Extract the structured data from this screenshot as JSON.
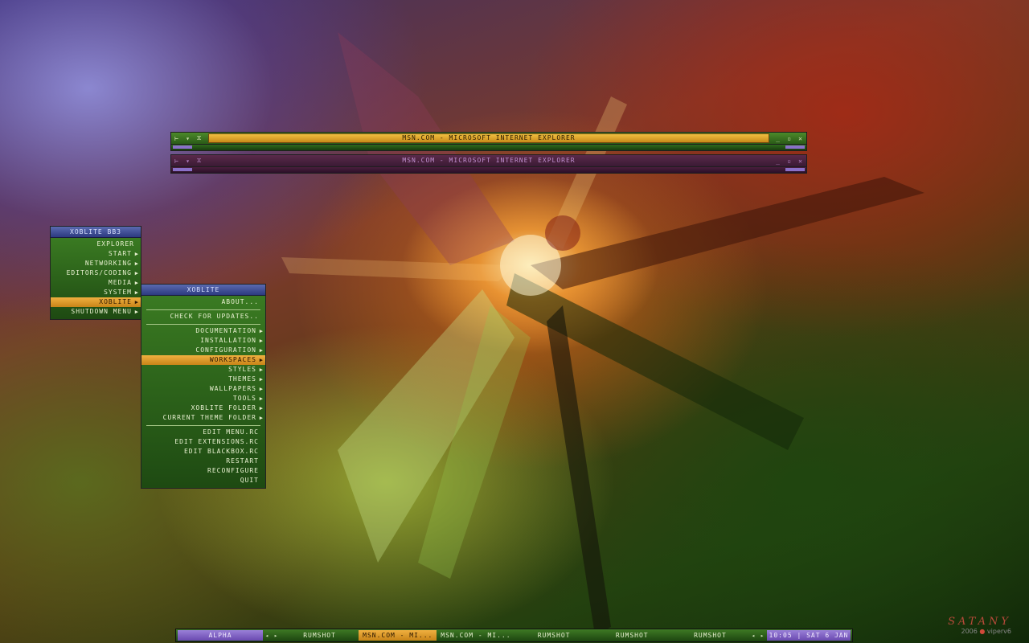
{
  "windows": [
    {
      "title": "MSN.COM - MICROSOFT INTERNET EXPLORER",
      "left_controls": [
        "⊢",
        "▾",
        "⧖"
      ],
      "right_controls": [
        "_",
        "▫",
        "✕"
      ],
      "state": "focused"
    },
    {
      "title": "MSN.COM - MICROSOFT INTERNET EXPLORER",
      "left_controls": [
        "⊢",
        "▾",
        "⧖"
      ],
      "right_controls": [
        "_",
        "▫",
        "✕"
      ],
      "state": "unfocused"
    }
  ],
  "root_menu": {
    "title": "XOBLITE BB3",
    "items": [
      {
        "label": "EXPLORER",
        "submenu": false
      },
      {
        "label": "START",
        "submenu": true
      },
      {
        "label": "NETWORKING",
        "submenu": true
      },
      {
        "label": "EDITORS/CODING",
        "submenu": true
      },
      {
        "label": "MEDIA",
        "submenu": true
      },
      {
        "label": "SYSTEM",
        "submenu": true
      },
      {
        "label": "XOBLITE",
        "submenu": true,
        "active": true
      },
      {
        "label": "SHUTDOWN MENU",
        "submenu": true
      }
    ]
  },
  "sub_menu": {
    "title": "XOBLITE",
    "groups": [
      [
        {
          "label": "ABOUT...",
          "submenu": false
        }
      ],
      [
        {
          "label": "CHECK FOR UPDATES..",
          "submenu": false
        }
      ],
      [
        {
          "label": "DOCUMENTATION",
          "submenu": true
        },
        {
          "label": "INSTALLATION",
          "submenu": true
        },
        {
          "label": "CONFIGURATION",
          "submenu": true
        },
        {
          "label": "WORKSPACES",
          "submenu": true,
          "active": true
        },
        {
          "label": "STYLES",
          "submenu": true
        },
        {
          "label": "THEMES",
          "submenu": true
        },
        {
          "label": "WALLPAPERS",
          "submenu": true
        },
        {
          "label": "TOOLS",
          "submenu": true
        },
        {
          "label": "XOBLITE FOLDER",
          "submenu": true
        },
        {
          "label": "CURRENT THEME FOLDER",
          "submenu": true
        }
      ],
      [
        {
          "label": "EDIT MENU.RC",
          "submenu": false
        },
        {
          "label": "EDIT EXTENSIONS.RC",
          "submenu": false
        },
        {
          "label": "EDIT BLACKBOX.RC",
          "submenu": false
        },
        {
          "label": "RESTART",
          "submenu": false
        },
        {
          "label": "RECONFIGURE",
          "submenu": false
        },
        {
          "label": "QUIT",
          "submenu": false
        }
      ]
    ]
  },
  "submenu_arrow": "▶",
  "taskbar": {
    "workspace": "ALPHA",
    "nav_prev": "◂",
    "nav_next": "▸",
    "tasks": [
      {
        "label": "RUMSHOT",
        "active": false
      },
      {
        "label": "MSN.COM - MI...",
        "active": true
      },
      {
        "label": "MSN.COM - MI...",
        "active": false
      },
      {
        "label": "RUMSHOT",
        "active": false
      },
      {
        "label": "RUMSHOT",
        "active": false
      },
      {
        "label": "RUMSHOT",
        "active": false
      }
    ],
    "clock": "10:05 | SAT 6 JAN"
  },
  "signature": {
    "name": "SATANY",
    "credit_year": "2006",
    "credit_dot": "●",
    "credit_author": "viperv6"
  },
  "colors": {
    "accent_orange": "#e8a030",
    "menu_green": "#2e6a1c",
    "title_blue": "#3a4a98",
    "workspace_purple": "#8a6ac8",
    "inactive_window": "#4a1e3c"
  }
}
